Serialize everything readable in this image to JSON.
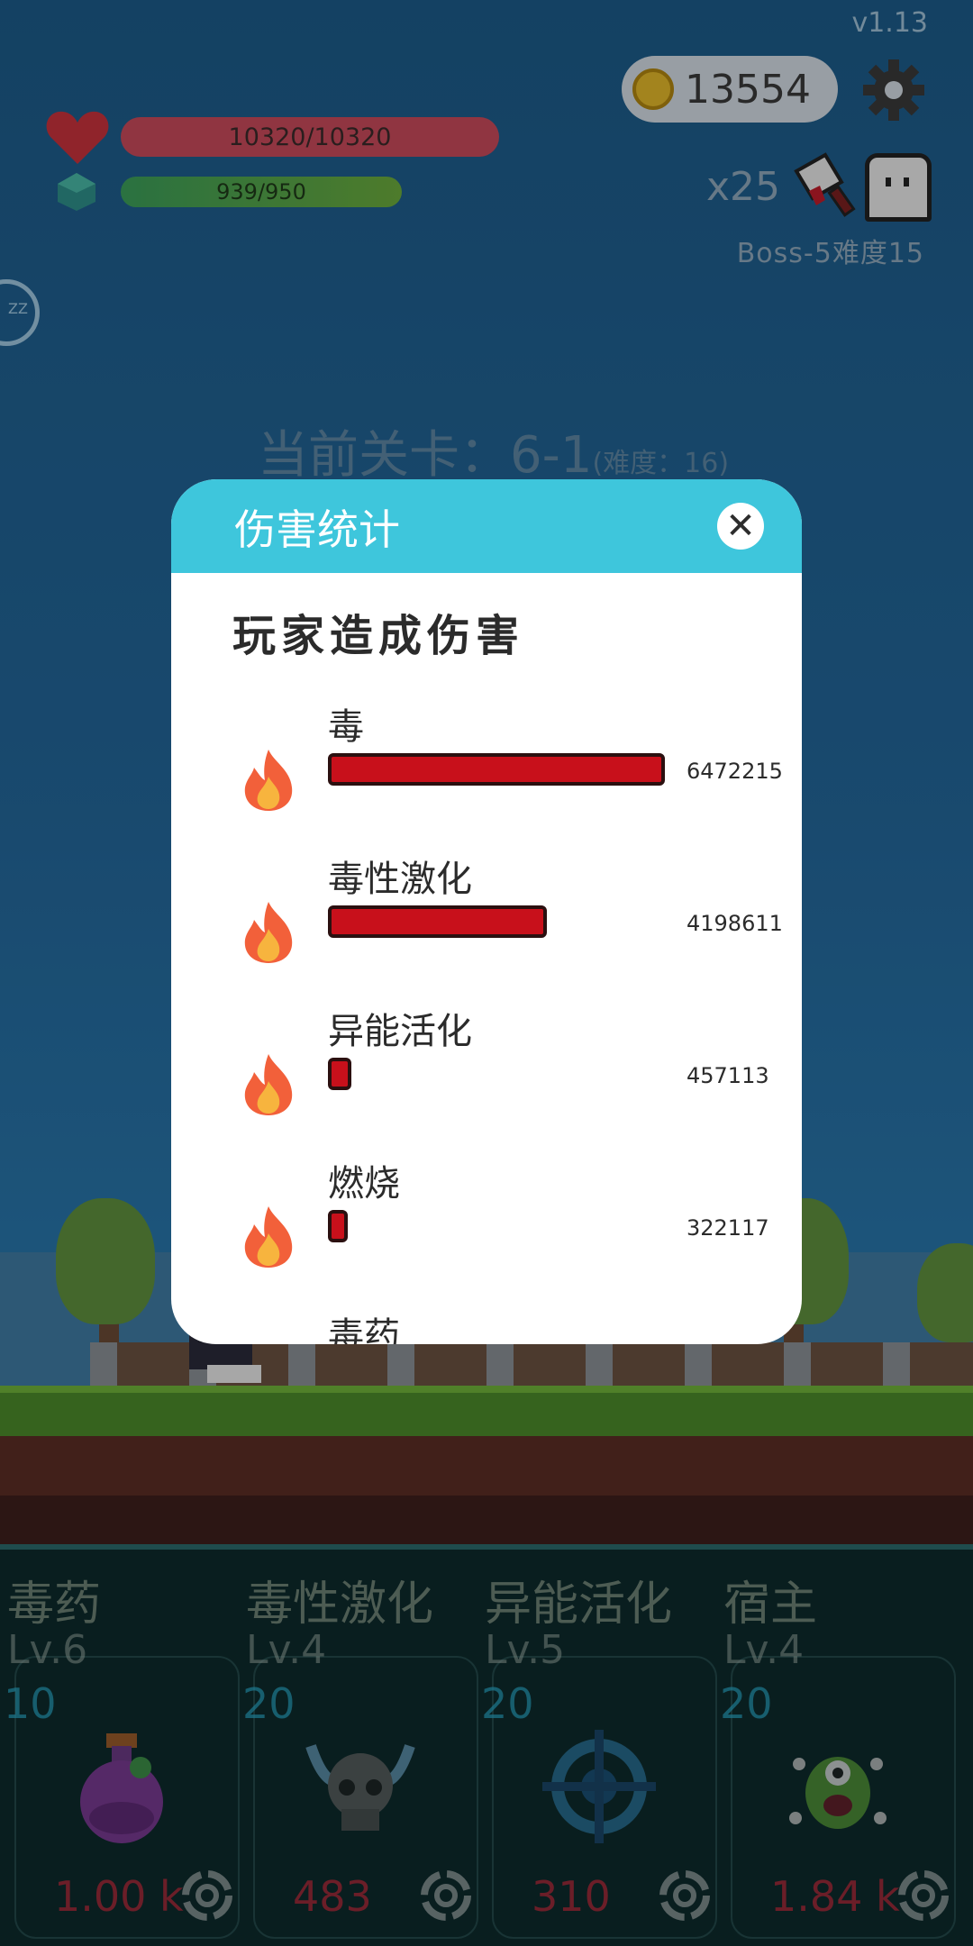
{
  "hud": {
    "version": "v1.13",
    "coins": "13554",
    "hp": "10320/10320",
    "mp": "939/950",
    "multiplier": "x25",
    "boss_info": "Boss-5难度15",
    "side_button": "ZZ",
    "level_label": "当前关卡：6-1",
    "level_difficulty": "(难度：16)"
  },
  "modal": {
    "title": "伤害统计",
    "close_icon": "close-icon",
    "subtitle": "玩家造成伤害",
    "rows": [
      {
        "name": "毒",
        "value": "6472215",
        "ratio": 1.0
      },
      {
        "name": "毒性激化",
        "value": "4198611",
        "ratio": 0.6487
      },
      {
        "name": "异能活化",
        "value": "457113",
        "ratio": 0.0706
      },
      {
        "name": "燃烧",
        "value": "322117",
        "ratio": 0.0498
      },
      {
        "name": "毒药",
        "value": "",
        "ratio": 0
      }
    ]
  },
  "skills": [
    {
      "name": "毒药",
      "level": "Lv.6",
      "cost": "10",
      "price": "1.00 k",
      "icon": "potion-icon"
    },
    {
      "name": "毒性激化",
      "level": "Lv.4",
      "cost": "20",
      "price": "483",
      "icon": "viking-skull-icon"
    },
    {
      "name": "异能活化",
      "level": "Lv.5",
      "cost": "20",
      "price": "310",
      "icon": "crosshair-icon"
    },
    {
      "name": "宿主",
      "level": "Lv.4",
      "cost": "20",
      "price": "1.84 k",
      "icon": "green-monster-icon"
    }
  ],
  "colors": {
    "modal_header": "#3ec6dc",
    "damage_bar": "#c8101b",
    "price": "#b72b3b",
    "cost": "#2aa9c8"
  }
}
